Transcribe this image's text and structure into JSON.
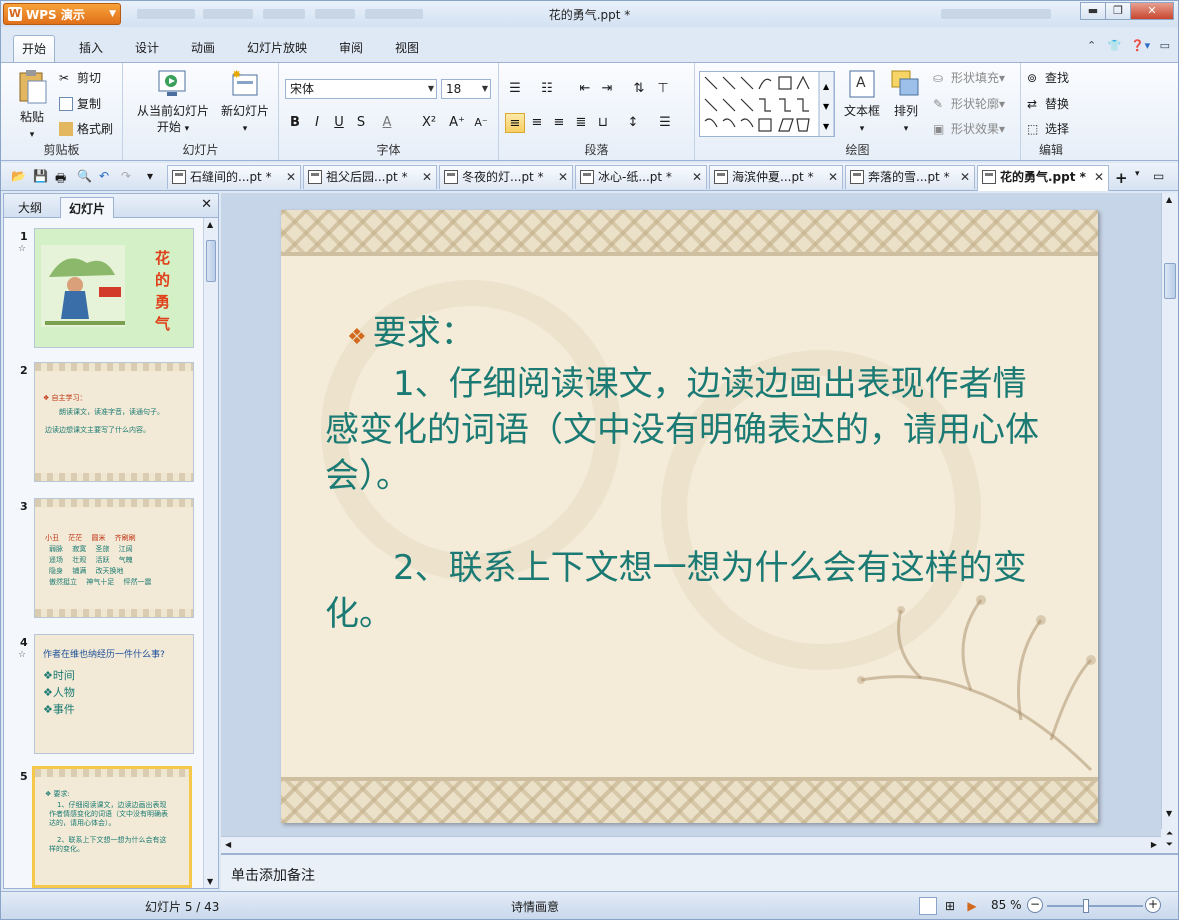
{
  "app": {
    "name": "WPS 演示",
    "title": "花的勇气.ppt *"
  },
  "menu": {
    "tabs": [
      "开始",
      "插入",
      "设计",
      "动画",
      "幻灯片放映",
      "审阅",
      "视图"
    ]
  },
  "ribbon": {
    "clipboard": {
      "label": "剪贴板",
      "paste": "粘贴",
      "cut": "剪切",
      "copy": "复制",
      "format_painter": "格式刷"
    },
    "slides": {
      "label": "幻灯片",
      "from_current": "从当前幻灯片",
      "start": "开始",
      "new_slide": "新幻灯片"
    },
    "font": {
      "label": "字体",
      "family": "宋体",
      "size": "18"
    },
    "paragraph": {
      "label": "段落"
    },
    "drawing": {
      "label": "绘图",
      "textbox": "文本框",
      "arrange": "排列",
      "shape_fill": "形状填充",
      "shape_outline": "形状轮廓",
      "shape_effects": "形状效果"
    },
    "edit": {
      "label": "编辑",
      "find": "查找",
      "replace": "替换",
      "select": "选择"
    }
  },
  "doc_tabs": [
    "石缝间的...pt *",
    "祖父后园...pt *",
    "冬夜的灯...pt *",
    "冰心-纸...pt *",
    "海滨仲夏...pt *",
    "奔落的雪...pt *",
    "花的勇气.ppt *"
  ],
  "panel": {
    "tabs": [
      "大纲",
      "幻灯片"
    ]
  },
  "thumbnails": [
    {
      "num": "1",
      "title_chars": [
        "花",
        "的",
        "勇",
        "气"
      ]
    },
    {
      "num": "2",
      "lines": [
        "❖ 自主学习：",
        "朗读课文，读准字音，读通句子。",
        "边读边想课文主要写了什么内容。"
      ]
    },
    {
      "num": "3",
      "lines": [
        "小丑　 茫茫　 圆米　 齐刷刷",
        "弱脉　 寂寞　 圣旅　 江阔",
        "遥场　 壮观　 活跃　 气魄",
        "隐身　 铺满　 改天换地",
        "傲然挺立　 神气十足　 怦然一震"
      ]
    },
    {
      "num": "4",
      "lines": [
        "作者在维也纳经历一件什么事?",
        "❖时间",
        "❖人物",
        "❖事件"
      ]
    },
    {
      "num": "5",
      "lines": [
        "❖ 要求:",
        "1、仔细阅读课文，边读边画出表现",
        "作者情感变化的词语（文中没有明确表",
        "达的，请用心体会）。",
        "2、联系上下文想一想为什么会有这",
        "样的变化。"
      ]
    }
  ],
  "slide": {
    "heading": "要求：",
    "item1": "1、仔细阅读课文，边读边画出表现作者情感变化的词语（文中没有明确表达的，请用心体会）。",
    "item2": "2、联系上下文想一想为什么会有这样的变化。"
  },
  "notes_placeholder": "单击添加备注",
  "status": {
    "slide_info": "幻灯片 5 / 43",
    "theme": "诗情画意",
    "zoom": "85 %"
  },
  "colors": {
    "accent": "#f08c1e",
    "slide_text": "#1b7a73",
    "bullet": "#d2691e"
  }
}
